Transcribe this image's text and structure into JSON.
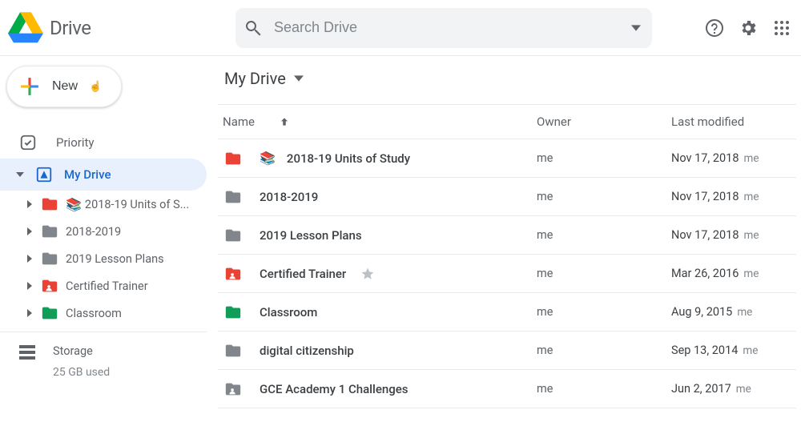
{
  "app": {
    "name": "Drive"
  },
  "search": {
    "placeholder": "Search Drive"
  },
  "newButton": {
    "label": "New"
  },
  "sidebar": {
    "priority": "Priority",
    "myDrive": "My Drive",
    "tree": [
      {
        "label": "2018-19 Units of S...",
        "color": "#ea4335",
        "emoji": "📚"
      },
      {
        "label": "2018-2019",
        "color": "#80868b"
      },
      {
        "label": "2019 Lesson Plans",
        "color": "#80868b"
      },
      {
        "label": "Certified Trainer",
        "color": "#ea4335",
        "shared": true
      },
      {
        "label": "Classroom",
        "color": "#0f9d58"
      }
    ],
    "storageLabel": "Storage",
    "storageUsed": "25 GB used"
  },
  "breadcrumb": {
    "label": "My Drive"
  },
  "columns": {
    "name": "Name",
    "owner": "Owner",
    "modified": "Last modified"
  },
  "files": [
    {
      "name": "2018-19 Units of Study",
      "owner": "me",
      "modified": "Nov 17, 2018",
      "by": "me",
      "color": "#ea4335",
      "emoji": "📚"
    },
    {
      "name": "2018-2019",
      "owner": "me",
      "modified": "Nov 17, 2018",
      "by": "me",
      "color": "#80868b"
    },
    {
      "name": "2019 Lesson Plans",
      "owner": "me",
      "modified": "Nov 17, 2018",
      "by": "me",
      "color": "#80868b"
    },
    {
      "name": "Certified Trainer",
      "owner": "me",
      "modified": "Mar 26, 2016",
      "by": "me",
      "color": "#ea4335",
      "shared": true,
      "starred": true
    },
    {
      "name": "Classroom",
      "owner": "me",
      "modified": "Aug 9, 2015",
      "by": "me",
      "color": "#0f9d58"
    },
    {
      "name": "digital citizenship",
      "owner": "me",
      "modified": "Sep 13, 2014",
      "by": "me",
      "color": "#80868b"
    },
    {
      "name": "GCE Academy 1 Challenges",
      "owner": "me",
      "modified": "Jun 2, 2017",
      "by": "me",
      "color": "#80868b",
      "shared": true
    }
  ]
}
